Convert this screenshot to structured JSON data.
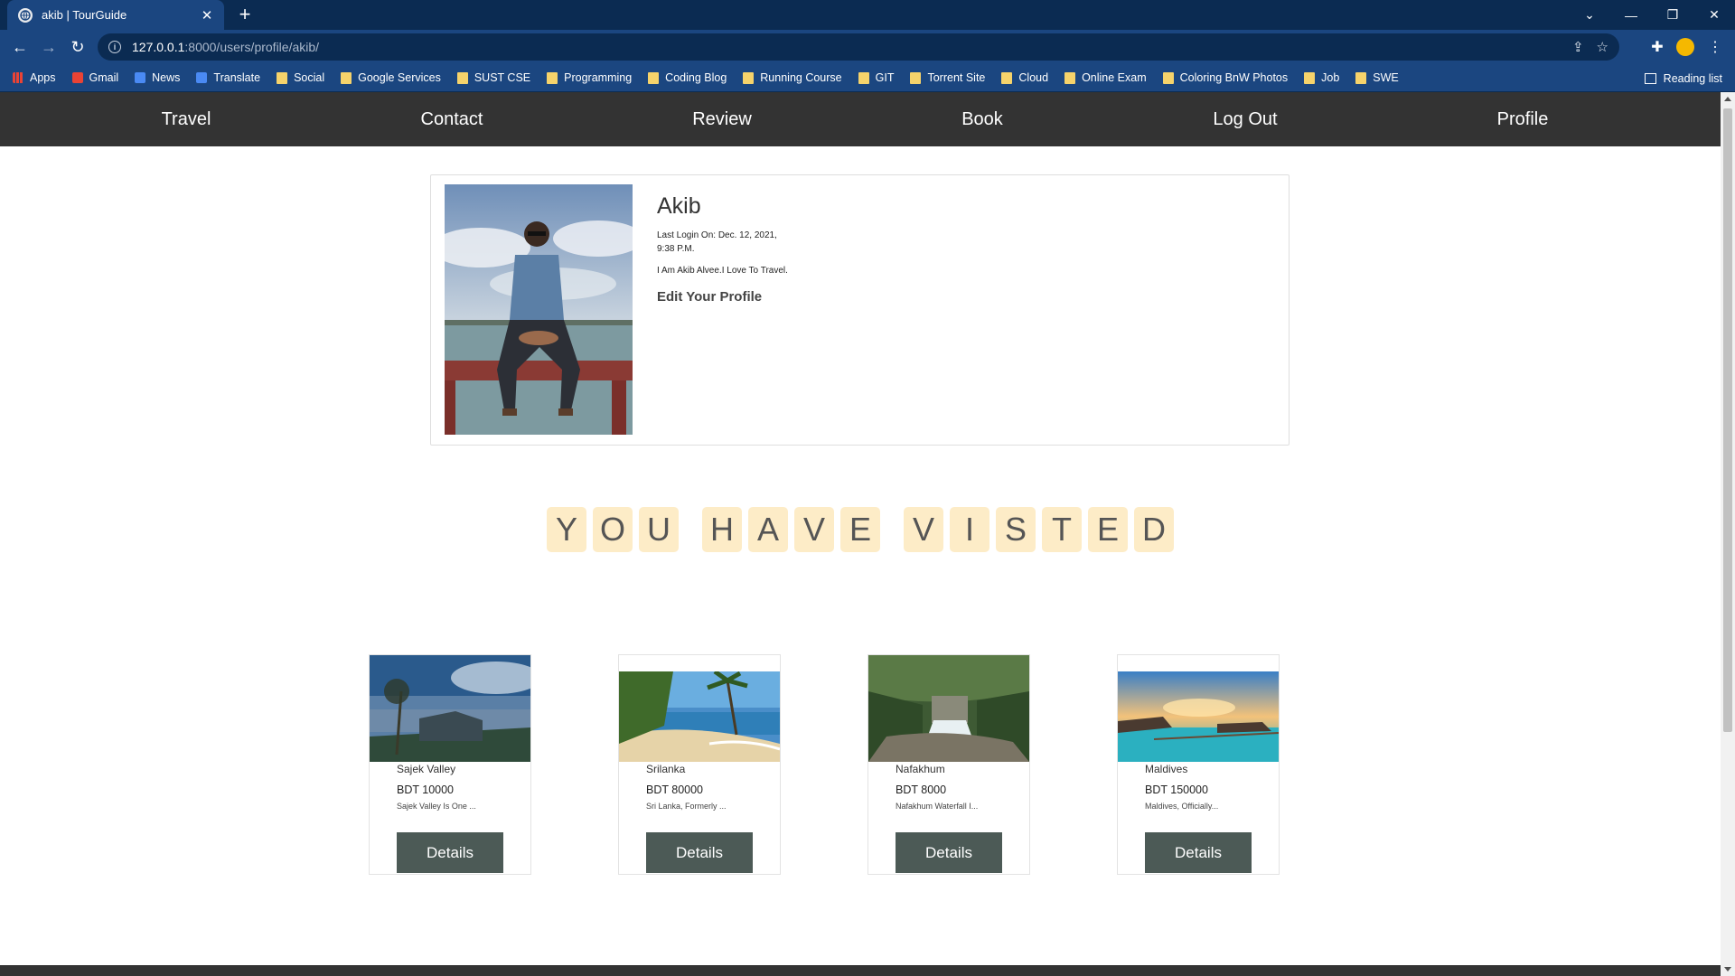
{
  "browser": {
    "tab_title": "akib | TourGuide",
    "tab_close": "✕",
    "new_tab": "+",
    "url_host": "127.0.0.1",
    "url_path": ":8000/users/profile/akib/",
    "bookmarks": [
      "Apps",
      "Gmail",
      "News",
      "Translate",
      "Social",
      "Google Services",
      "SUST CSE",
      "Programming",
      "Coding Blog",
      "Running Course",
      "GIT",
      "Torrent Site",
      "Cloud",
      "Online Exam",
      "Coloring BnW Photos",
      "Job",
      "SWE"
    ],
    "reading_list": "Reading list"
  },
  "nav": {
    "travel": "Travel",
    "contact": "Contact",
    "review": "Review",
    "book": "Book",
    "logout": "Log Out",
    "profile": "Profile"
  },
  "profile": {
    "name": "Akib",
    "last_login": "Last Login On: Dec. 12, 2021, 9:38 P.M.",
    "bio": "I Am Akib Alvee.I Love To Travel.",
    "edit_link": "Edit Your Profile"
  },
  "visited_heading": {
    "words": [
      [
        "Y",
        "O",
        "U"
      ],
      [
        "H",
        "A",
        "V",
        "E"
      ],
      [
        "V",
        "I",
        "S",
        "T",
        "E",
        "D"
      ]
    ]
  },
  "destinations": [
    {
      "name": "Sajek Valley",
      "price": "BDT 10000",
      "desc": "Sajek Valley Is One ...",
      "button": "Details"
    },
    {
      "name": "Srilanka",
      "price": "BDT 80000",
      "desc": "Sri Lanka, Formerly ...",
      "button": "Details"
    },
    {
      "name": "Nafakhum",
      "price": "BDT 8000",
      "desc": "Nafakhum Waterfall I...",
      "button": "Details"
    },
    {
      "name": "Maldives",
      "price": "BDT 150000",
      "desc": "Maldives, Officially...",
      "button": "Details"
    }
  ]
}
